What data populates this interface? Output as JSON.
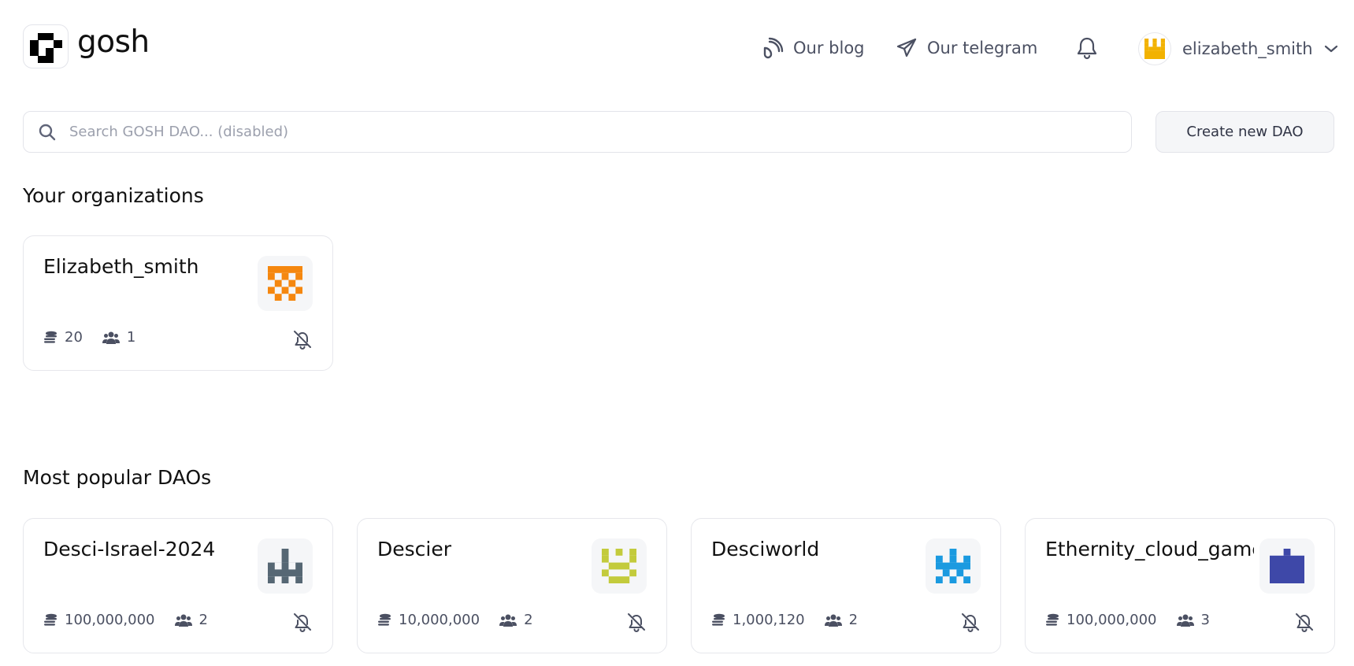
{
  "header": {
    "logo_text": "gosh",
    "blog_label": "Our blog",
    "telegram_label": "Our telegram",
    "username": "elizabeth_smith"
  },
  "search": {
    "placeholder": "Search GOSH DAO... (disabled)",
    "create_label": "Create new DAO"
  },
  "sections": {
    "your_title": "Your organizations",
    "popular_title": "Most popular DAOs"
  },
  "your_orgs": [
    {
      "name": "Elizabeth_smith",
      "supply": "20",
      "members": "1",
      "avatar_color": "#f5870f"
    }
  ],
  "popular_daos": [
    {
      "name": "Desci-Israel-2024",
      "supply": "100,000,000",
      "members": "2",
      "avatar_color": "#566774"
    },
    {
      "name": "Descier",
      "supply": "10,000,000",
      "members": "2",
      "avatar_color": "#c3cb3c"
    },
    {
      "name": "Desciworld",
      "supply": "1,000,120",
      "members": "2",
      "avatar_color": "#1b9ae0"
    },
    {
      "name": "Ethernity_cloud_game",
      "supply": "100,000,000",
      "members": "3",
      "avatar_color": "#3e48a8"
    }
  ],
  "icons": {
    "logo": "gosh-logo-icon",
    "blog": "rss-icon",
    "telegram": "paper-plane-icon",
    "notifications": "bell-icon",
    "dropdown": "chevron-down-icon",
    "search": "search-icon",
    "supply": "coins-icon",
    "members": "users-icon",
    "mute": "bell-slash-icon"
  },
  "colors": {
    "user_avatar": "#f2b200"
  }
}
